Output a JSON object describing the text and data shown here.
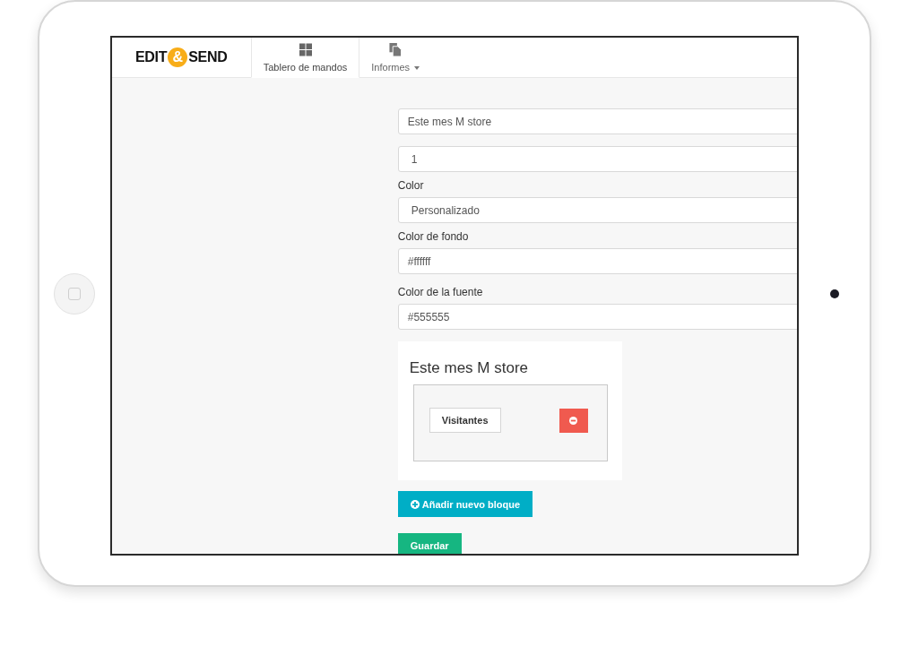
{
  "logo": {
    "left": "EDIT",
    "mark": "&",
    "right": "SEND"
  },
  "tabs": [
    {
      "label": "Tablero de mandos",
      "selected": true,
      "kind": "plain"
    },
    {
      "label": "Informes",
      "selected": false,
      "kind": "dropdown"
    }
  ],
  "fields": [
    {
      "value": "Este mes M store",
      "kind": "text"
    },
    {
      "value": "1",
      "kind": "select"
    },
    {
      "label": "Color",
      "value": "Personalizado",
      "kind": "select"
    },
    {
      "label": "Color de fondo",
      "value": "#ffffff",
      "kind": "text"
    },
    {
      "label": "Color de la fuente",
      "value": "#555555",
      "kind": "text"
    }
  ],
  "preview": {
    "title": "Este mes M store",
    "blocks": [
      {
        "label": "Visitantes"
      }
    ]
  },
  "add_button": "Añadir nuevo bloque",
  "save_button": "Guardar"
}
